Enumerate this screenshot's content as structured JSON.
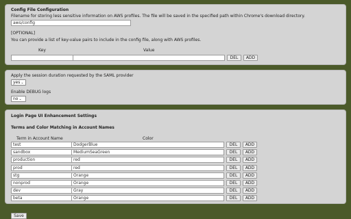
{
  "config_file": {
    "title": "Config File Configuration",
    "description": "Filename for storing less sensitive information on AWS profiles. The file will be saved in the specified path within Chrome's download directory.",
    "filename_value": "aws/config",
    "optional_label": "[OPTIONAL]",
    "kv_description": "You can provide a list of key-value pairs to include in the config file, along with AWS profiles.",
    "key_header": "Key",
    "value_header": "Value",
    "key_value": "",
    "value_value": "",
    "del_label": "DEL",
    "add_label": "ADD"
  },
  "session": {
    "duration_label": "Apply the session duration requested by the SAML provider",
    "duration_selected": "yes",
    "debug_label": "Enable DEBUG logs",
    "debug_selected": "no"
  },
  "login_ui": {
    "title": "Login Page UI Enhancement Settings",
    "subtitle": "Terms and Color Matching in Account Names",
    "term_header": "Term in Account Name",
    "color_header": "Color",
    "del_label": "DEL",
    "add_label": "ADD",
    "rows": [
      {
        "term": "test",
        "color": "DodgerBlue"
      },
      {
        "term": "sandbox",
        "color": "MediumSeaGreen"
      },
      {
        "term": "production",
        "color": "red"
      },
      {
        "term": "prod",
        "color": "red"
      },
      {
        "term": "stg",
        "color": "Orange"
      },
      {
        "term": "nonprod",
        "color": "Orange"
      },
      {
        "term": "dev",
        "color": "Gray"
      },
      {
        "term": "beta",
        "color": "Orange"
      }
    ]
  },
  "save_label": "Save"
}
